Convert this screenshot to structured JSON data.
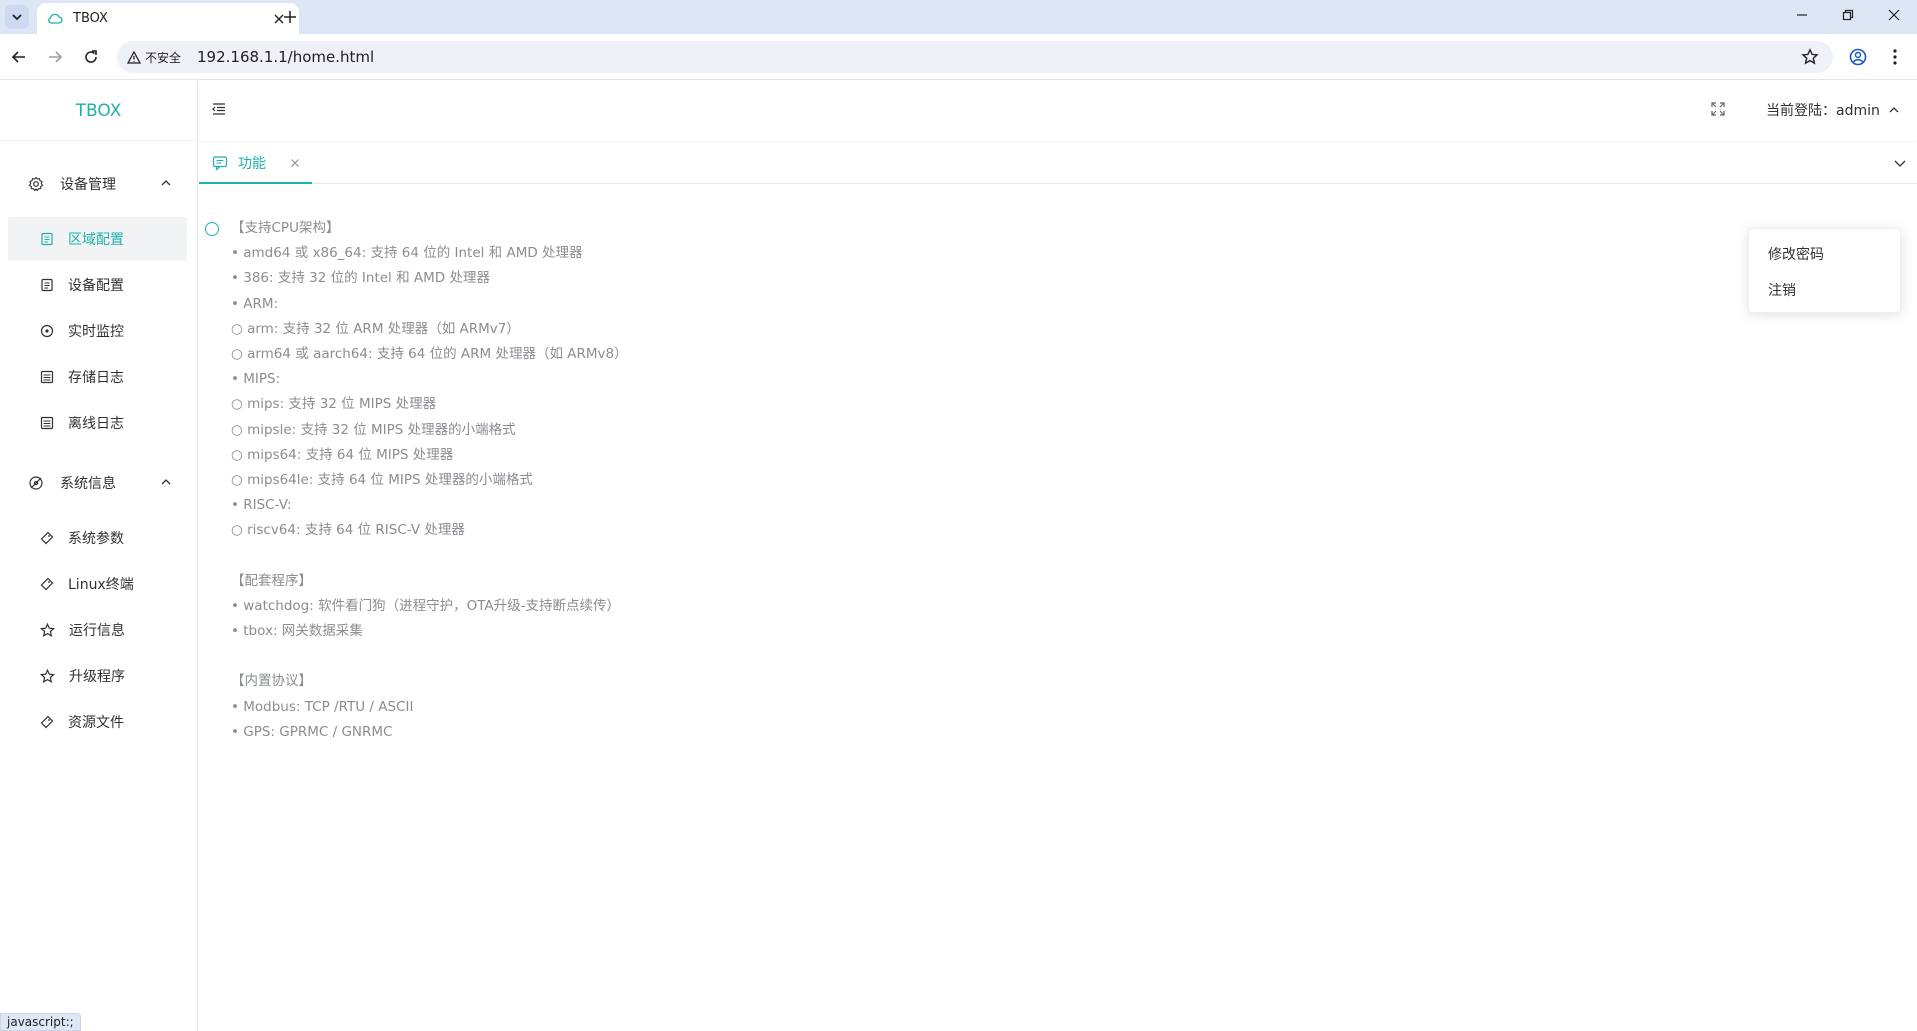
{
  "browser": {
    "tab_title": "TBOX",
    "security_label": "不安全",
    "url": "192.168.1.1/home.html",
    "status_text": "javascript:;"
  },
  "app": {
    "logo": "TBOX",
    "user_label": "当前登陆：admin",
    "tab_label": "功能"
  },
  "sidebar": {
    "groups": [
      {
        "label": "设备管理",
        "items": [
          {
            "label": "区域配置",
            "active": true
          },
          {
            "label": "设备配置"
          },
          {
            "label": "实时监控"
          },
          {
            "label": "存储日志"
          },
          {
            "label": "离线日志"
          }
        ]
      },
      {
        "label": "系统信息",
        "items": [
          {
            "label": "系统参数"
          },
          {
            "label": "Linux终端"
          },
          {
            "label": "运行信息"
          },
          {
            "label": "升级程序"
          },
          {
            "label": "资源文件"
          }
        ]
      }
    ]
  },
  "dropdown": {
    "items": [
      "修改密码",
      "注销"
    ]
  },
  "content": {
    "lines": [
      "【支持CPU架构】",
      "• amd64 或 x86_64: 支持 64 位的 Intel 和 AMD 处理器",
      "• 386: 支持 32 位的 Intel 和 AMD 处理器",
      "• ARM:",
      "○ arm: 支持 32 位 ARM 处理器（如 ARMv7）",
      "○ arm64 或 aarch64: 支持 64 位的 ARM 处理器（如 ARMv8）",
      "• MIPS:",
      "○ mips: 支持 32 位 MIPS 处理器",
      "○ mipsle: 支持 32 位 MIPS 处理器的小端格式",
      "○ mips64: 支持 64 位 MIPS 处理器",
      "○ mips64le: 支持 64 位 MIPS 处理器的小端格式",
      "• RISC-V:",
      "○ riscv64: 支持 64 位 RISC-V 处理器",
      "",
      "【配套程序】",
      "• watchdog: 软件看门狗（进程守护，OTA升级-支持断点续传）",
      "• tbox: 网关数据采集",
      "",
      "【内置协议】",
      "• Modbus: TCP /RTU / ASCII",
      "• GPS: GPRMC / GNRMC"
    ]
  },
  "colors": {
    "accent": "#20b2aa",
    "text": "#303133",
    "muted": "#8a8d93"
  }
}
